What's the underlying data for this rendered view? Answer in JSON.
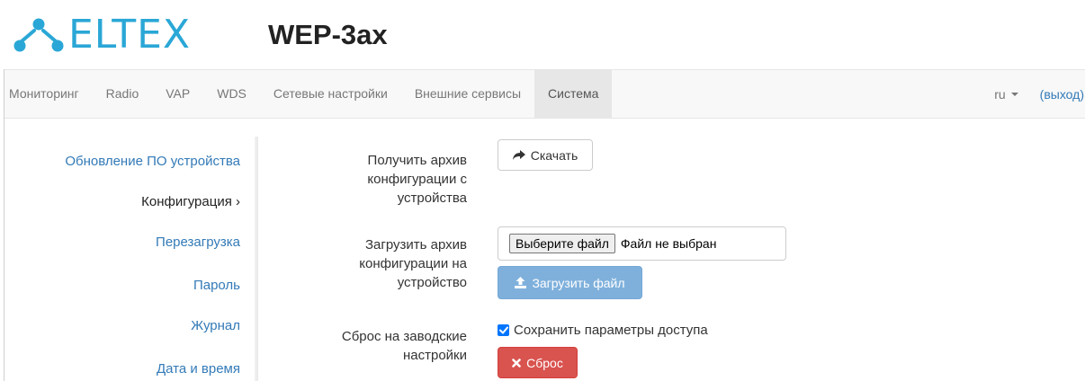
{
  "header": {
    "logo_text": "ELTEX",
    "device_title": "WEP-3ax"
  },
  "navbar": {
    "items": [
      {
        "label": "Мониторинг"
      },
      {
        "label": "Radio"
      },
      {
        "label": "VAP"
      },
      {
        "label": "WDS"
      },
      {
        "label": "Сетевые настройки"
      },
      {
        "label": "Внешние сервисы"
      },
      {
        "label": "Система",
        "active": true
      }
    ],
    "language": "ru",
    "logout": "(выход)"
  },
  "sidebar": {
    "items": [
      {
        "label": "Обновление ПО устройства"
      },
      {
        "label": "Конфигурация ›",
        "active": true
      },
      {
        "label": "Перезагрузка"
      },
      {
        "label": "Пароль"
      },
      {
        "label": "Журнал"
      },
      {
        "label": "Дата и время"
      }
    ]
  },
  "config": {
    "download": {
      "label_lines": [
        "Получить архив",
        "конфигурации с",
        "устройства"
      ],
      "button": "Скачать",
      "icon": "share-arrow-icon"
    },
    "upload": {
      "label_lines": [
        "Загрузить архив",
        "конфигурации на",
        "устройство"
      ],
      "file_button": "Выберите файл",
      "file_status": "Файл не выбран",
      "button": "Загрузить файл",
      "icon": "upload-icon"
    },
    "reset": {
      "label_lines": [
        "Сброс на заводские",
        "настройки"
      ],
      "checkbox_label": "Сохранить параметры доступа",
      "checkbox_checked": true,
      "button": "Сброс",
      "icon": "cross-icon"
    }
  },
  "colors": {
    "brand": "#2aa7d6",
    "link": "#337ab7",
    "danger": "#d9534f",
    "primary_disabled": "#7fb0dc"
  }
}
